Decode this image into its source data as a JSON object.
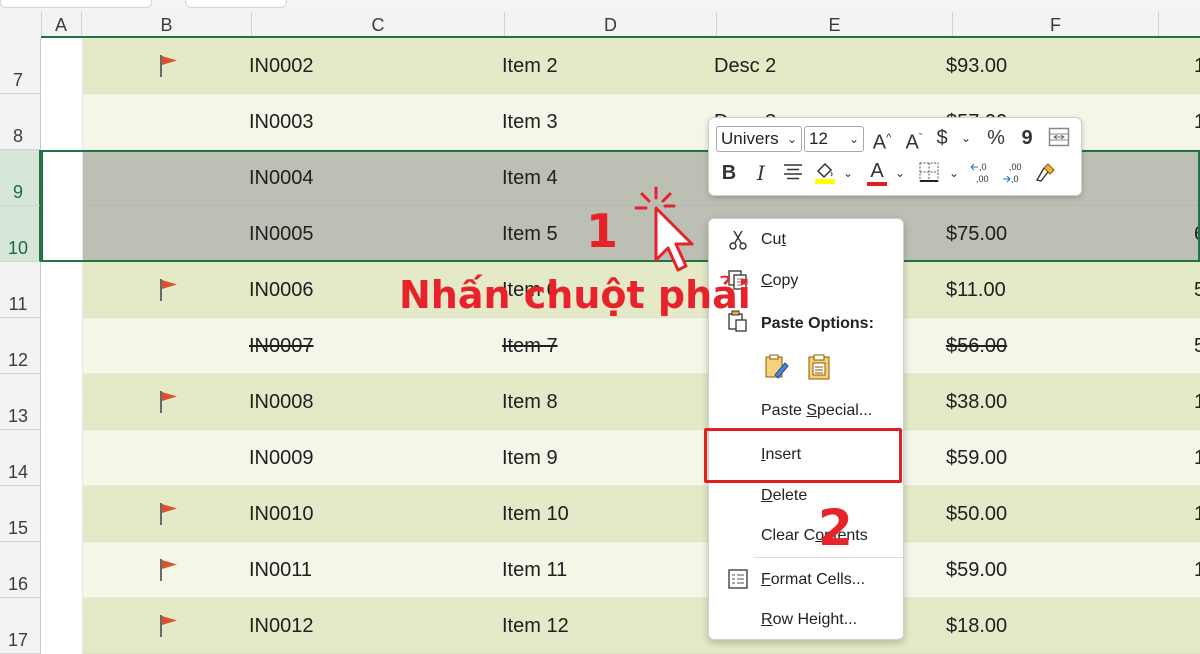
{
  "columns": [
    "A",
    "B",
    "C",
    "D",
    "E",
    "F"
  ],
  "rows": [
    {
      "num": "7",
      "flag": true,
      "id": "IN0002",
      "item": "Item 2",
      "desc": "Desc 2",
      "price": "$93.00",
      "edge": "1",
      "strike": false
    },
    {
      "num": "8",
      "flag": false,
      "id": "IN0003",
      "item": "Item 3",
      "desc": "Desc 3",
      "price": "$57.00",
      "edge": "1",
      "strike": false
    },
    {
      "num": "9",
      "flag": false,
      "id": "IN0004",
      "item": "Item 4",
      "desc": "",
      "price": "",
      "edge": "",
      "strike": false
    },
    {
      "num": "10",
      "flag": false,
      "id": "IN0005",
      "item": "Item 5",
      "desc": "",
      "price": "$75.00",
      "edge": "6",
      "strike": false
    },
    {
      "num": "11",
      "flag": true,
      "id": "IN0006",
      "item": "Item 6",
      "desc": "",
      "price": "$11.00",
      "edge": "5",
      "strike": false
    },
    {
      "num": "12",
      "flag": false,
      "id": "IN0007",
      "item": "Item 7",
      "desc": "",
      "price": "$56.00",
      "edge": "5",
      "strike": true
    },
    {
      "num": "13",
      "flag": true,
      "id": "IN0008",
      "item": "Item 8",
      "desc": "",
      "price": "$38.00",
      "edge": "1",
      "strike": false
    },
    {
      "num": "14",
      "flag": false,
      "id": "IN0009",
      "item": "Item 9",
      "desc": "",
      "price": "$59.00",
      "edge": "1",
      "strike": false
    },
    {
      "num": "15",
      "flag": true,
      "id": "IN0010",
      "item": "Item 10",
      "desc": "",
      "price": "$50.00",
      "edge": "1",
      "strike": false
    },
    {
      "num": "16",
      "flag": true,
      "id": "IN0011",
      "item": "Item 11",
      "desc": "",
      "price": "$59.00",
      "edge": "1",
      "strike": false
    },
    {
      "num": "17",
      "flag": true,
      "id": "IN0012",
      "item": "Item 12",
      "desc": "",
      "price": "$18.00",
      "edge": "",
      "strike": false
    }
  ],
  "minitoolbar": {
    "font": "Univers",
    "size": "12",
    "grow_font": "A",
    "shrink_font": "A",
    "currency": "$",
    "percent": "%",
    "comma": "9",
    "bold": "B",
    "italic": "I",
    "font_color": "A"
  },
  "context_menu": {
    "cut": "Cut",
    "copy": "Copy",
    "paste_options": "Paste Options:",
    "paste_special": "Paste Special...",
    "insert": "Insert",
    "delete": "Delete",
    "clear_contents": "Clear Contents",
    "format_cells": "Format Cells...",
    "row_height": "Row Height..."
  },
  "annotations": {
    "step1": "1",
    "step1_text": "Nhấn chuột phải",
    "step2": "2"
  },
  "colors": {
    "row_band_a": "#e4eac8",
    "row_band_b": "#f4f6e8",
    "selected_row": "#bcbfb4",
    "excel_green": "#217346",
    "annotation_red": "#e8222a",
    "flag_red": "#d9532c"
  }
}
